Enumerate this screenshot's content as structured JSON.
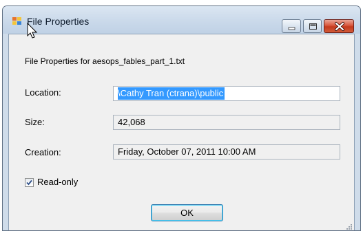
{
  "window": {
    "title": "File Properties",
    "icon": "app-window-icon",
    "controls": {
      "minimize": "minimize-icon",
      "maximize": "maximize-icon",
      "close": "close-icon"
    }
  },
  "dialog": {
    "heading": "File Properties for  aesops_fables_part_1.txt",
    "location": {
      "label": "Location:",
      "value": "\\Cathy Tran (ctrana)\\public"
    },
    "size": {
      "label": "Size:",
      "value": "42,068"
    },
    "creation": {
      "label": "Creation:",
      "value": "Friday, October 07, 2011 10:00 AM"
    },
    "readonly": {
      "label": "Read-only",
      "checked": true
    },
    "ok_label": "OK"
  },
  "colors": {
    "selection": "#3399ff",
    "chrome": "#cfdcea",
    "close_button": "#c43a1c"
  }
}
